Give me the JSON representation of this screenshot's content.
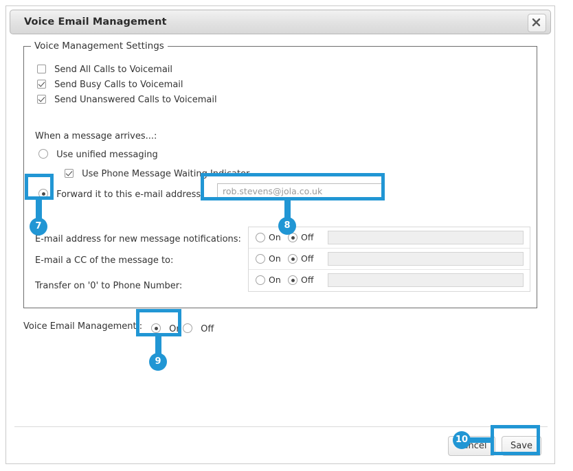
{
  "window": {
    "title": "Voice Email Management",
    "close_icon": "close-icon"
  },
  "fieldset": {
    "legend": "Voice Management Settings"
  },
  "checkboxes": [
    {
      "label": "Send All Calls to Voicemail",
      "checked": false
    },
    {
      "label": "Send Busy Calls to Voicemail",
      "checked": true
    },
    {
      "label": "Send Unanswered Calls to Voicemail",
      "checked": true
    }
  ],
  "arrival": {
    "heading": "When a message arrives...:",
    "unified_label": "Use unified messaging",
    "unified_selected": false,
    "mwi_label": "Use Phone Message Waiting Indicator",
    "mwi_checked": true,
    "forward_label": "Forward it to this e-mail address:",
    "forward_selected": true,
    "email_value": "rob.stevens@jola.co.uk"
  },
  "options": {
    "on_label": "On",
    "off_label": "Off",
    "rows": [
      {
        "label": "E-mail address for new message notifications:",
        "state": "Off",
        "field_value": ""
      },
      {
        "label": "E-mail a CC of the message to:",
        "state": "Off",
        "field_value": ""
      },
      {
        "label": "Transfer on '0' to Phone Number:",
        "state": "Off",
        "field_value": ""
      }
    ]
  },
  "master": {
    "label": "Voice Email Management :",
    "on_label": "On",
    "off_label": "Off",
    "state": "On"
  },
  "footer": {
    "cancel_label": "Cancel",
    "save_label": "Save"
  },
  "annotations": {
    "accent_color": "#2196d4",
    "badges": [
      {
        "number": "7"
      },
      {
        "number": "8"
      },
      {
        "number": "9"
      },
      {
        "number": "10"
      }
    ]
  }
}
